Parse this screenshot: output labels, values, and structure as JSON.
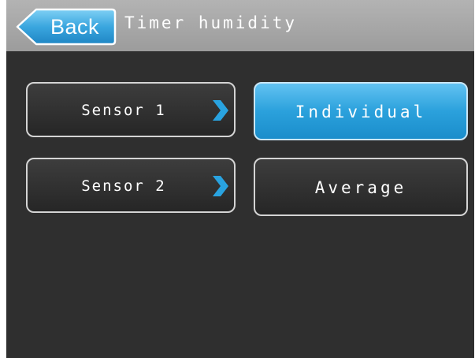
{
  "header": {
    "back_label": "Back",
    "title": "Timer humidity"
  },
  "sensors": [
    {
      "label": "Sensor 1",
      "icon": "chevron-right-icon"
    },
    {
      "label": "Sensor 2",
      "icon": "chevron-right-icon"
    }
  ],
  "modes": [
    {
      "label": "Individual",
      "selected": true
    },
    {
      "label": "Average",
      "selected": false
    }
  ],
  "colors": {
    "header": "#a8a8a8",
    "background": "#2f2f2f",
    "accent": "#2ba1dc",
    "chevron": "#29a3e0",
    "button_border": "#d4d4d4"
  }
}
